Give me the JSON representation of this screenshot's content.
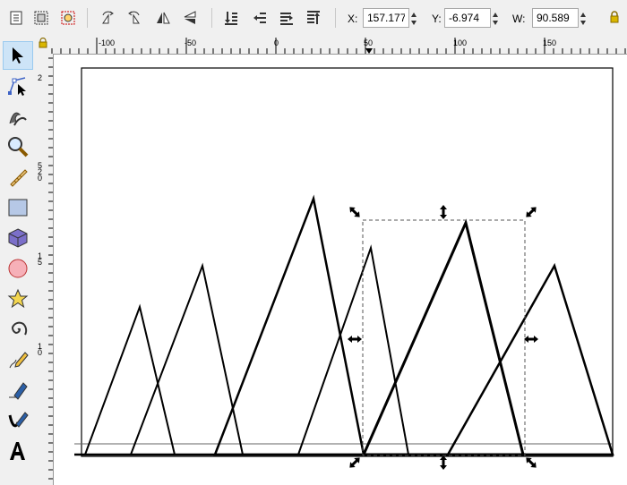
{
  "toolbar": {
    "x_label": "X:",
    "x_value": "157.177",
    "y_label": "Y:",
    "y_value": "-6.974",
    "w_label": "W:",
    "w_value": "90.589",
    "buttons": [
      "select-all-icon",
      "select-all-in-all-layers-icon",
      "deselect-icon",
      "rotate-ccw-icon",
      "rotate-cw-icon",
      "flip-horizontal-icon",
      "flip-vertical-icon",
      "raise-to-top-icon",
      "raise-icon",
      "lower-icon",
      "lower-to-bottom-icon"
    ]
  },
  "ruler": {
    "h_labels": [
      "-100",
      "-50",
      "0",
      "50",
      "100",
      "150"
    ],
    "v_labels": [
      "2",
      "5",
      "2",
      "0",
      "1",
      "5",
      "1",
      "0"
    ]
  },
  "tools": [
    "selector-arrow-icon",
    "node-editor-icon",
    "tweak-icon",
    "zoom-icon",
    "measure-icon",
    "rectangle-icon",
    "3d-box-icon",
    "ellipse-icon",
    "star-icon",
    "spiral-icon",
    "pencil-icon",
    "pen-icon",
    "calligraphy-icon",
    "text-icon"
  ],
  "accent": "#cde4f7"
}
